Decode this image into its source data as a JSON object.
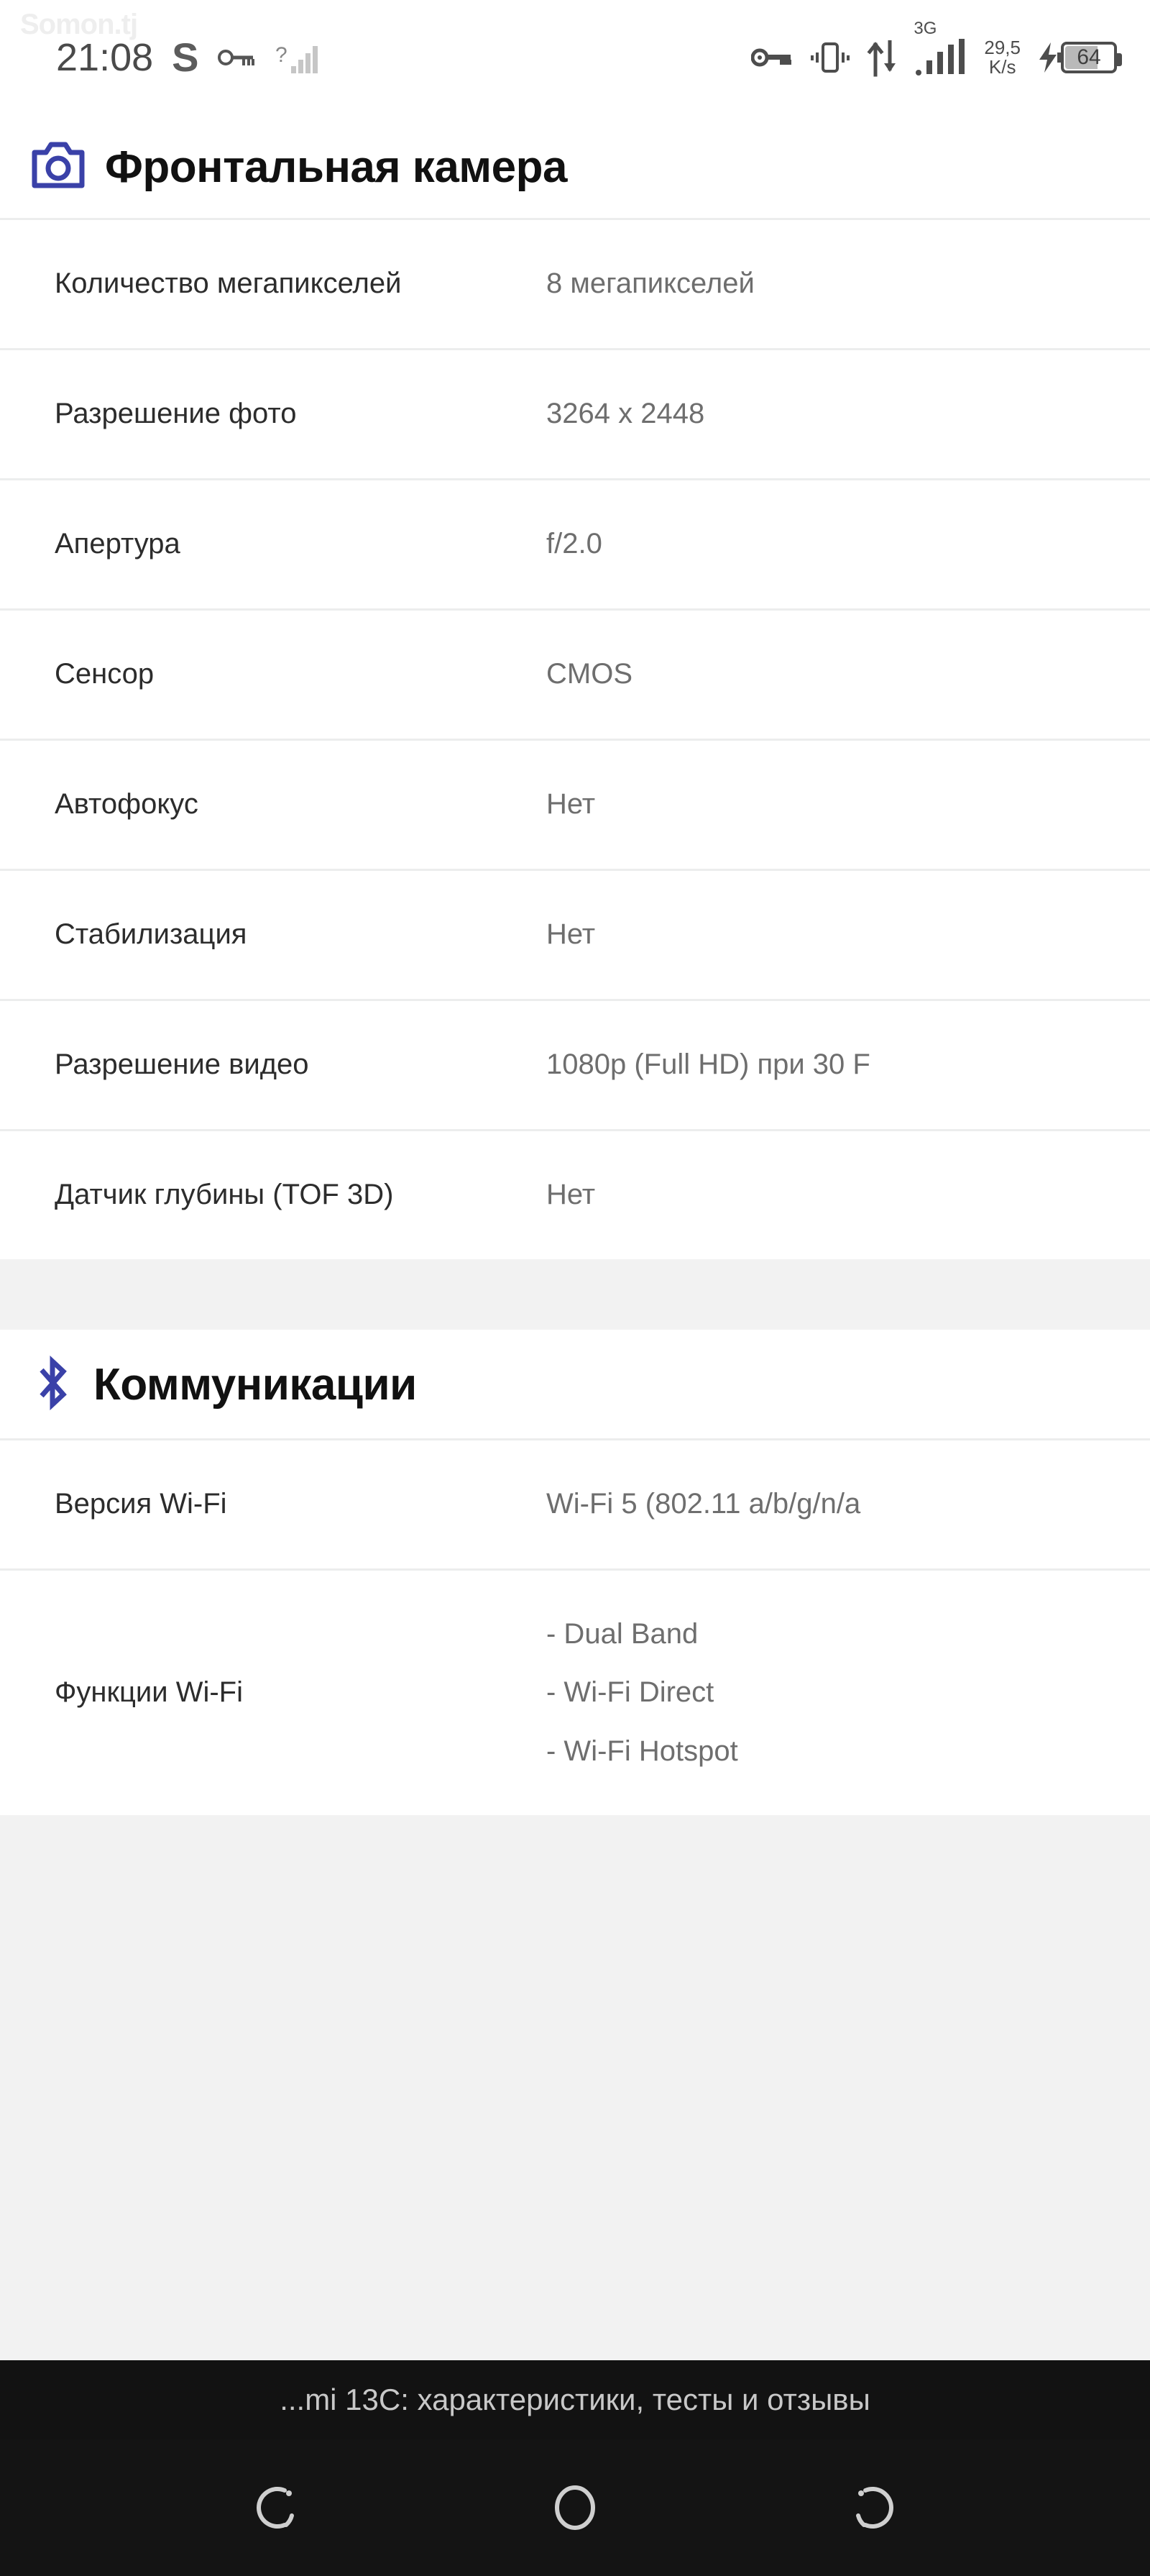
{
  "status_bar": {
    "watermark": "Somon.tj",
    "time": "21:08",
    "carrier_letter": "S",
    "key_icon": "key-icon",
    "question_signal_icon": "unknown-signal-icon",
    "vpn_key_icon": "key-icon",
    "vibrate_icon": "vibrate-icon",
    "data_transfer_icon": "data-transfer-icon",
    "network_type": "3G",
    "signal_icon": "signal-bars-icon",
    "net_speed_value": "29,5",
    "net_speed_unit": "K/s",
    "charging_icon": "charging-bolt-icon",
    "battery_level": "64"
  },
  "sections": [
    {
      "icon": "camera-icon",
      "title": "Фронтальная камера",
      "rows": [
        {
          "label": "Количество мегапикселей",
          "value": "8 мегапикселей"
        },
        {
          "label": "Разрешение фото",
          "value": "3264 x 2448"
        },
        {
          "label": "Апертура",
          "value": "f/2.0"
        },
        {
          "label": "Сенсор",
          "value": "CMOS"
        },
        {
          "label": "Автофокус",
          "value": "Нет"
        },
        {
          "label": "Стабилизация",
          "value": "Нет"
        },
        {
          "label": "Разрешение видео",
          "value": "1080p (Full HD) при 30 F"
        },
        {
          "label": "Датчик глубины (TOF 3D)",
          "value": "Нет"
        }
      ]
    },
    {
      "icon": "bluetooth-icon",
      "title": "Коммуникации",
      "rows": [
        {
          "label": "Версия Wi-Fi",
          "value": "Wi-Fi 5 (802.11 a/b/g/n/a"
        },
        {
          "label": "Функции Wi-Fi",
          "value": "- Dual Band\n- Wi-Fi Direct\n- Wi-Fi Hotspot"
        }
      ]
    }
  ],
  "bottom_bar": {
    "title": "...mi 13C: характеристики, тесты и отзывы"
  },
  "nav_bar": {
    "recents_icon": "recents-icon",
    "home_icon": "home-circle-icon",
    "back_icon": "back-icon"
  },
  "colors": {
    "accent": "#3a41a8",
    "label_text": "#2c2c2c",
    "value_text": "#6e6e6e",
    "divider": "#eceded",
    "page_bg": "#f2f2f2",
    "card_bg": "#ffffff",
    "navbar_bg": "#141414"
  }
}
